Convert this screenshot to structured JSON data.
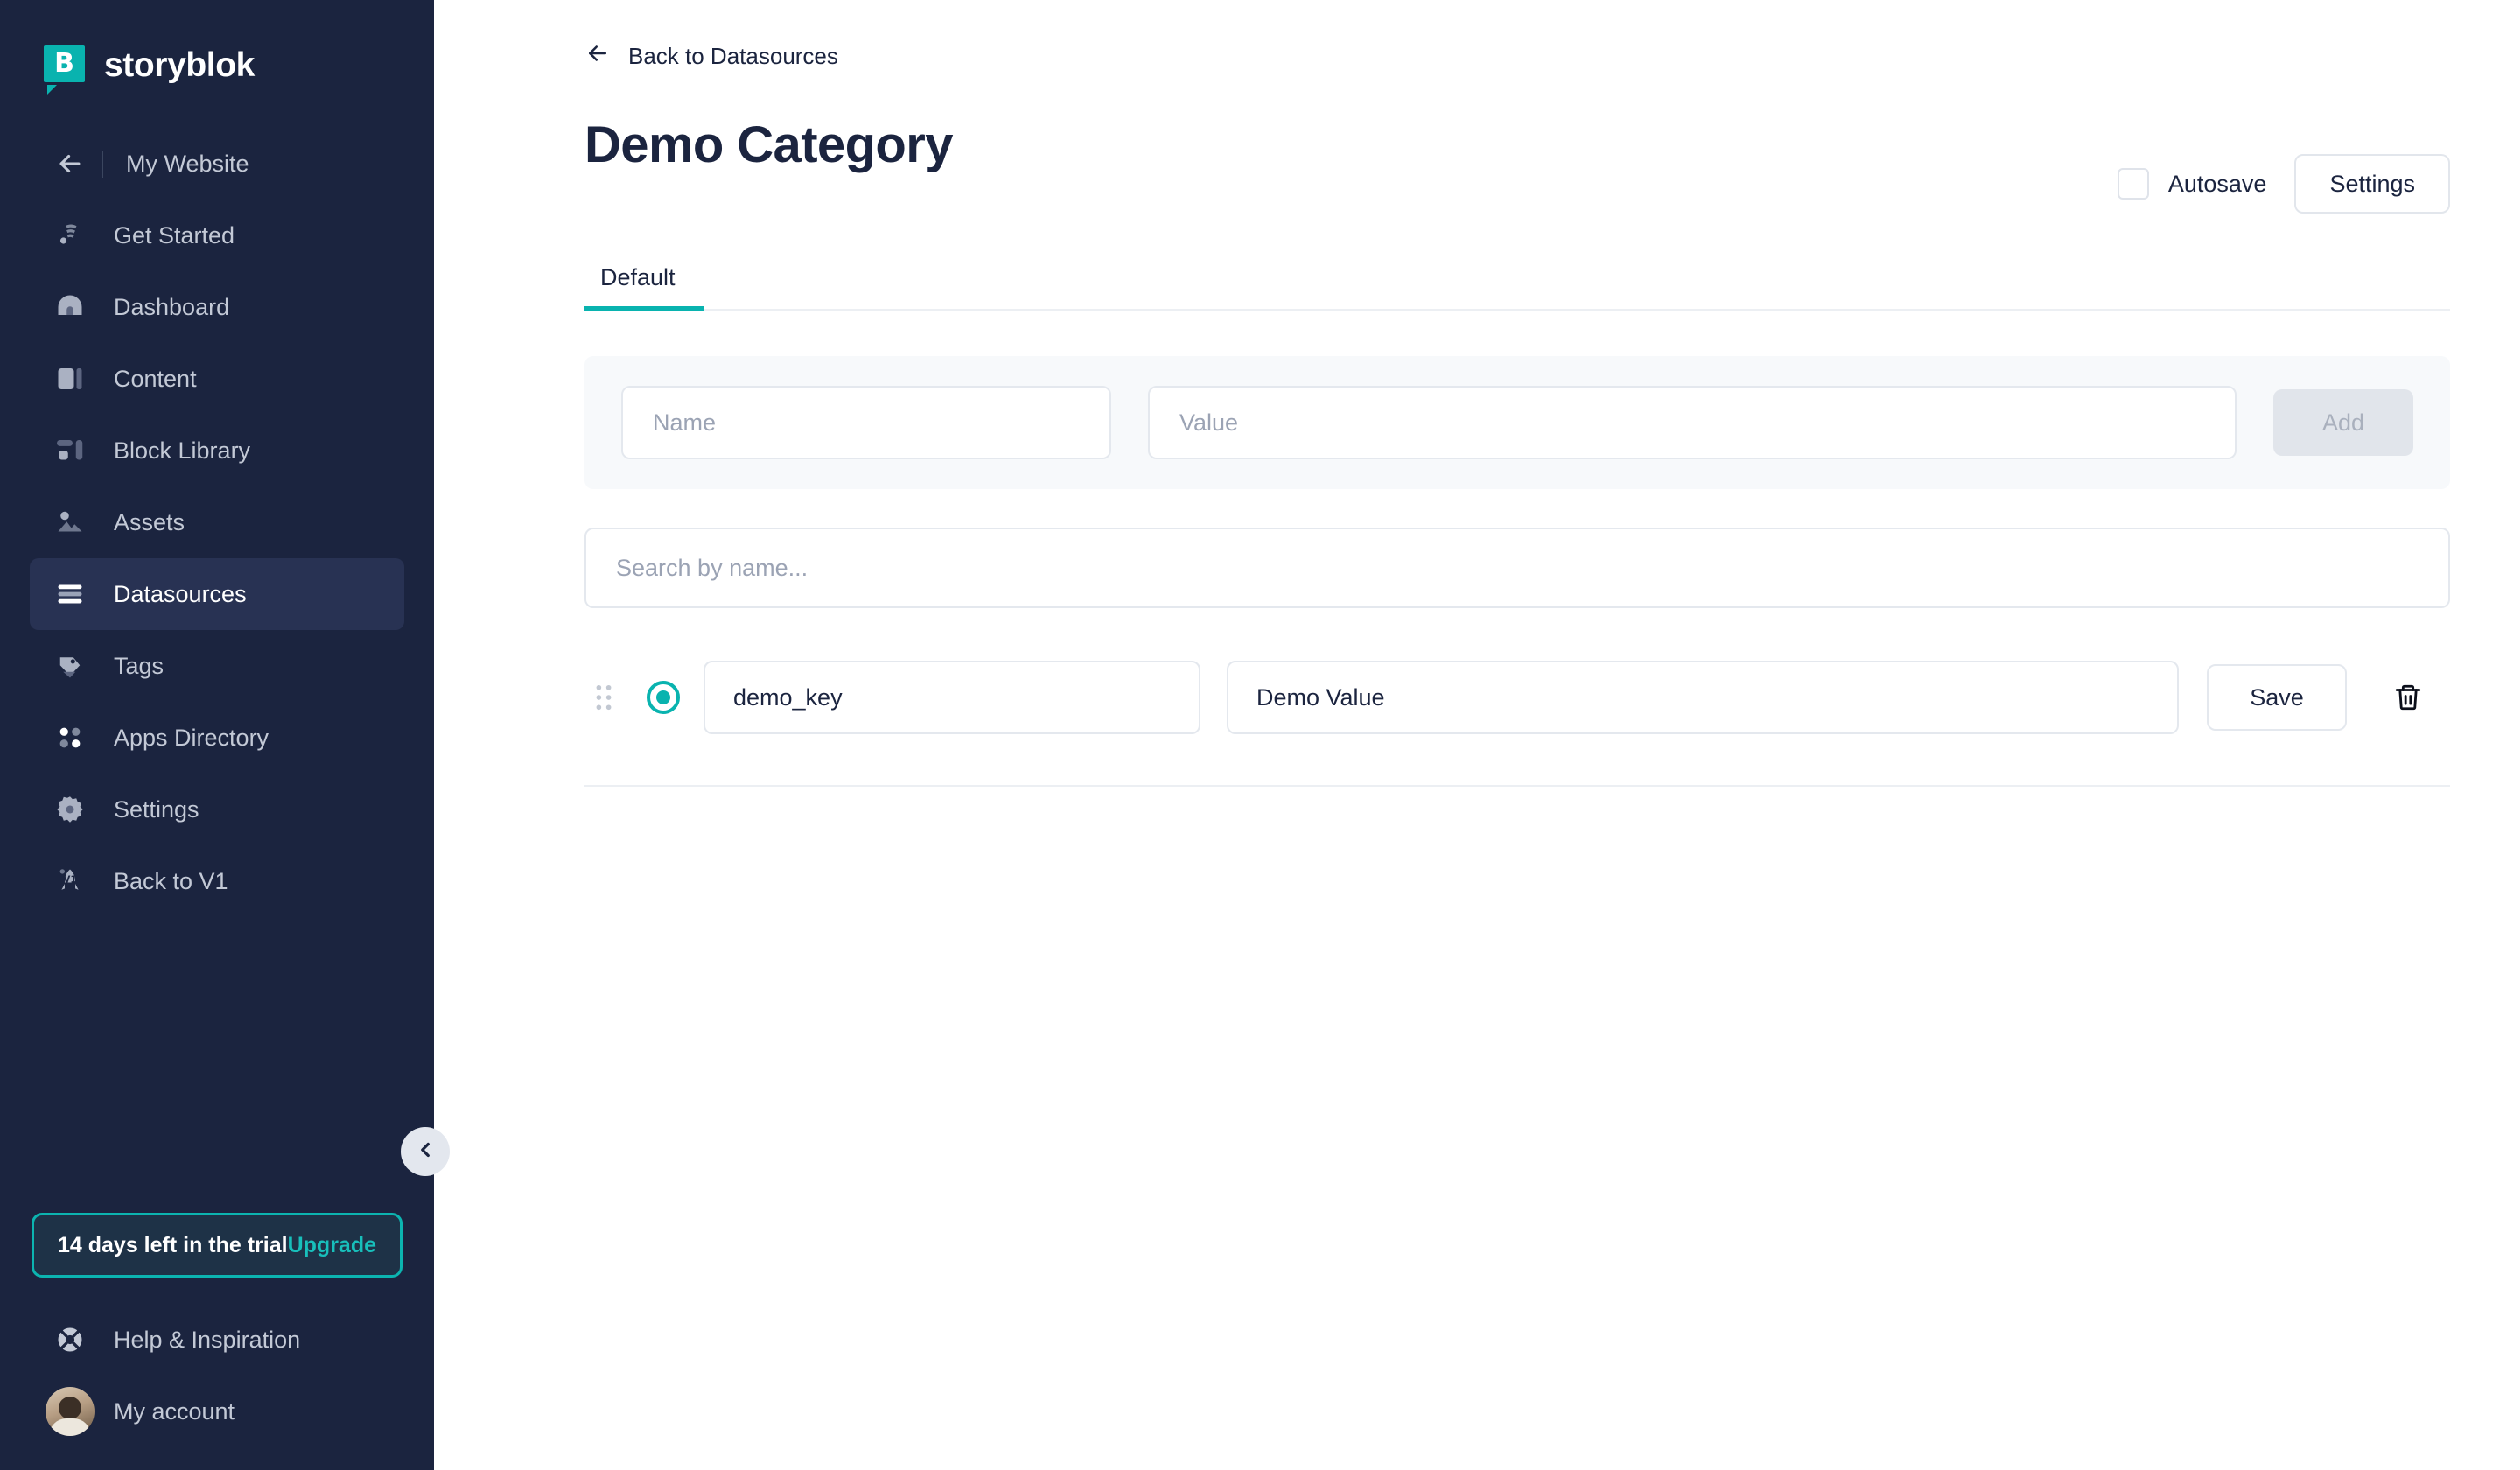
{
  "brand": {
    "name": "storyblok",
    "logo_letter": "B",
    "logo_icon": "storyblok-logo-icon"
  },
  "sidebar": {
    "items": [
      {
        "label": "My Website",
        "icon": "arrow-left-icon",
        "active": false
      },
      {
        "label": "Get Started",
        "icon": "waving-hand-icon",
        "active": false
      },
      {
        "label": "Dashboard",
        "icon": "dashboard-icon",
        "active": false
      },
      {
        "label": "Content",
        "icon": "content-icon",
        "active": false
      },
      {
        "label": "Block Library",
        "icon": "block-library-icon",
        "active": false
      },
      {
        "label": "Assets",
        "icon": "assets-icon",
        "active": false
      },
      {
        "label": "Datasources",
        "icon": "datasources-icon",
        "active": true
      },
      {
        "label": "Tags",
        "icon": "tag-icon",
        "active": false
      },
      {
        "label": "Apps Directory",
        "icon": "apps-directory-icon",
        "active": false
      },
      {
        "label": "Settings",
        "icon": "gear-icon",
        "active": false
      },
      {
        "label": "Back to V1",
        "icon": "rocket-icon",
        "active": false
      }
    ],
    "trial": {
      "text": "14 days left in the trial",
      "upgrade_label": "Upgrade"
    },
    "help": {
      "label": "Help & Inspiration",
      "icon": "lifebuoy-icon"
    },
    "account": {
      "label": "My account",
      "icon": "avatar"
    },
    "collapse": {
      "icon": "chevron-left-icon"
    }
  },
  "header": {
    "back_label": "Back to Datasources",
    "back_icon": "arrow-left-icon",
    "title": "Demo Category",
    "autosave_label": "Autosave",
    "autosave_checked": false,
    "settings_label": "Settings"
  },
  "tabs": [
    {
      "label": "Default",
      "active": true
    }
  ],
  "add_form": {
    "name_placeholder": "Name",
    "name_value": "",
    "value_placeholder": "Value",
    "value_value": "",
    "add_label": "Add",
    "add_disabled": true
  },
  "search": {
    "placeholder": "Search by name...",
    "value": ""
  },
  "rows": [
    {
      "drag_icon": "drag-handle-icon",
      "selected": true,
      "key": "demo_key",
      "value": "Demo Value",
      "save_label": "Save",
      "delete_icon": "trash-icon"
    }
  ],
  "colors": {
    "sidebar_bg": "#1b243f",
    "sidebar_active": "#283253",
    "accent_teal": "#09b3af",
    "text_dark": "#1b243f",
    "panel_bg": "#f7f9fb",
    "border": "#e4e8ee"
  }
}
